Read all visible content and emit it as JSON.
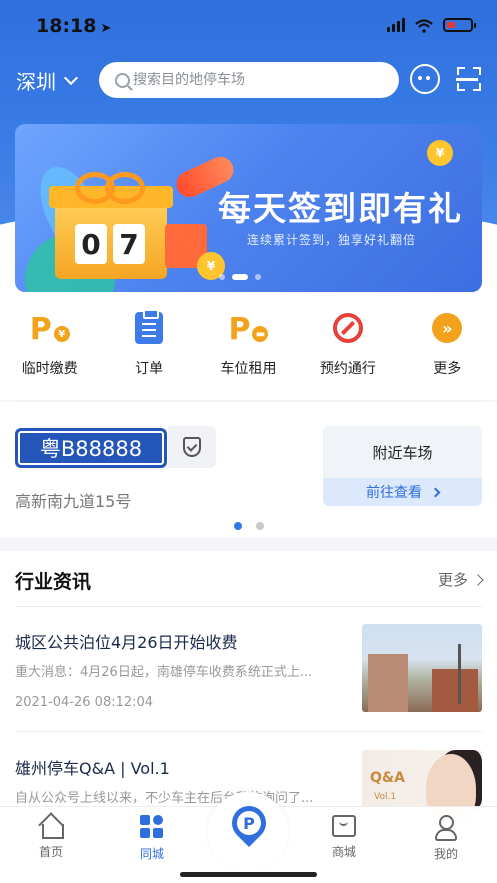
{
  "status_bar": {
    "time": "18:18"
  },
  "topbar": {
    "city": "深圳",
    "search_placeholder": "搜索目的地停车场"
  },
  "banner": {
    "title": "每天签到即有礼",
    "subtitle": "连续累计签到，独享好礼翻倍",
    "counter_digits": [
      "0",
      "7"
    ],
    "coin_symbol": "¥",
    "slide_count": 3,
    "active_slide": 1
  },
  "quick_actions": [
    {
      "label": "临时缴费",
      "icon": "parking-pay-icon"
    },
    {
      "label": "订单",
      "icon": "order-icon"
    },
    {
      "label": "车位租用",
      "icon": "parking-rent-icon"
    },
    {
      "label": "预约通行",
      "icon": "no-entry-icon"
    },
    {
      "label": "更多",
      "icon": "more-icon"
    }
  ],
  "vehicle": {
    "plate": "粤B88888",
    "address": "高新南九道15号",
    "nearby_title": "附近车场",
    "nearby_action": "前往查看"
  },
  "vehicle_pager": {
    "count": 2,
    "active": 0
  },
  "news": {
    "header": "行业资讯",
    "more": "更多",
    "articles": [
      {
        "title": "城区公共泊位4月26日开始收费",
        "summary": "重大消息：4月26日起，南雄停车收费系统正式上...",
        "date": "2021-04-26 08:12:04"
      },
      {
        "title": "雄州停车Q&A | Vol.1",
        "summary": "自从公众号上线以来，不少车主在后台私信询问了...",
        "thumb_text": "Q&A",
        "thumb_sub": "Vol.1"
      }
    ]
  },
  "tabbar": {
    "tabs": [
      {
        "label": "首页"
      },
      {
        "label": "同城"
      },
      {
        "label": "商城"
      },
      {
        "label": "我的"
      }
    ],
    "center_glyph": "P",
    "active": "同城"
  },
  "colors": {
    "primary": "#2f6fdd",
    "accent_orange": "#f2a31b",
    "danger": "#e8413a",
    "plate_blue": "#2356b8"
  }
}
